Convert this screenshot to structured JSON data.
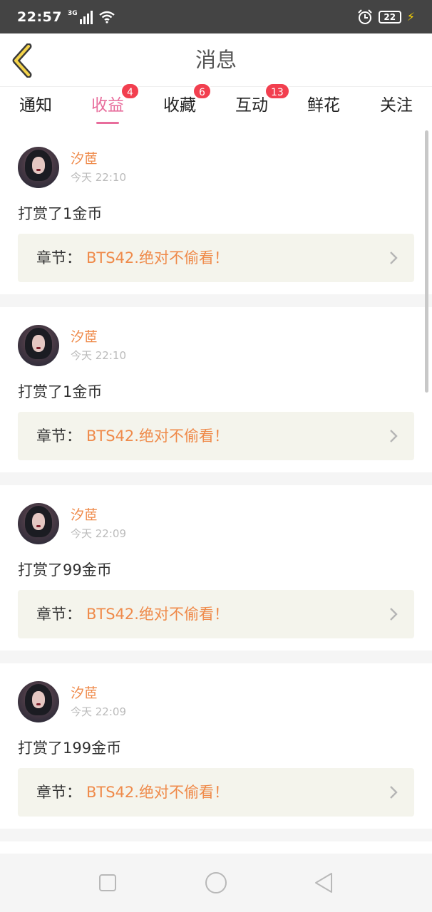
{
  "status_bar": {
    "time": "22:57",
    "network": "3G",
    "battery": "22"
  },
  "header": {
    "title": "消息"
  },
  "tabs": [
    {
      "label": "通知",
      "badge": null,
      "active": false
    },
    {
      "label": "收益",
      "badge": "4",
      "active": true
    },
    {
      "label": "收藏",
      "badge": "6",
      "active": false
    },
    {
      "label": "互动",
      "badge": "13",
      "active": false
    },
    {
      "label": "鲜花",
      "badge": null,
      "active": false
    },
    {
      "label": "关注",
      "badge": null,
      "active": false
    }
  ],
  "messages": [
    {
      "user": "汐茝",
      "time": "今天 22:10",
      "text": "打赏了1金币",
      "chapter_label": "章节：",
      "chapter_title": "BTS42.绝对不偷看！"
    },
    {
      "user": "汐茝",
      "time": "今天 22:10",
      "text": "打赏了1金币",
      "chapter_label": "章节：",
      "chapter_title": "BTS42.绝对不偷看！"
    },
    {
      "user": "汐茝",
      "time": "今天 22:09",
      "text": "打赏了99金币",
      "chapter_label": "章节：",
      "chapter_title": "BTS42.绝对不偷看！"
    },
    {
      "user": "汐茝",
      "time": "今天 22:09",
      "text": "打赏了199金币",
      "chapter_label": "章节：",
      "chapter_title": "BTS42.绝对不偷看！"
    }
  ],
  "colors": {
    "accent": "#e86d9c",
    "username": "#ef8a4a",
    "badge": "#f23f4f",
    "back_arrow_fill": "#f5d44a"
  },
  "icons": {
    "back": "back-arrow-icon",
    "chapter": "chevron-right-icon",
    "nav": [
      "square-recent-icon",
      "circle-home-icon",
      "triangle-back-icon"
    ]
  }
}
